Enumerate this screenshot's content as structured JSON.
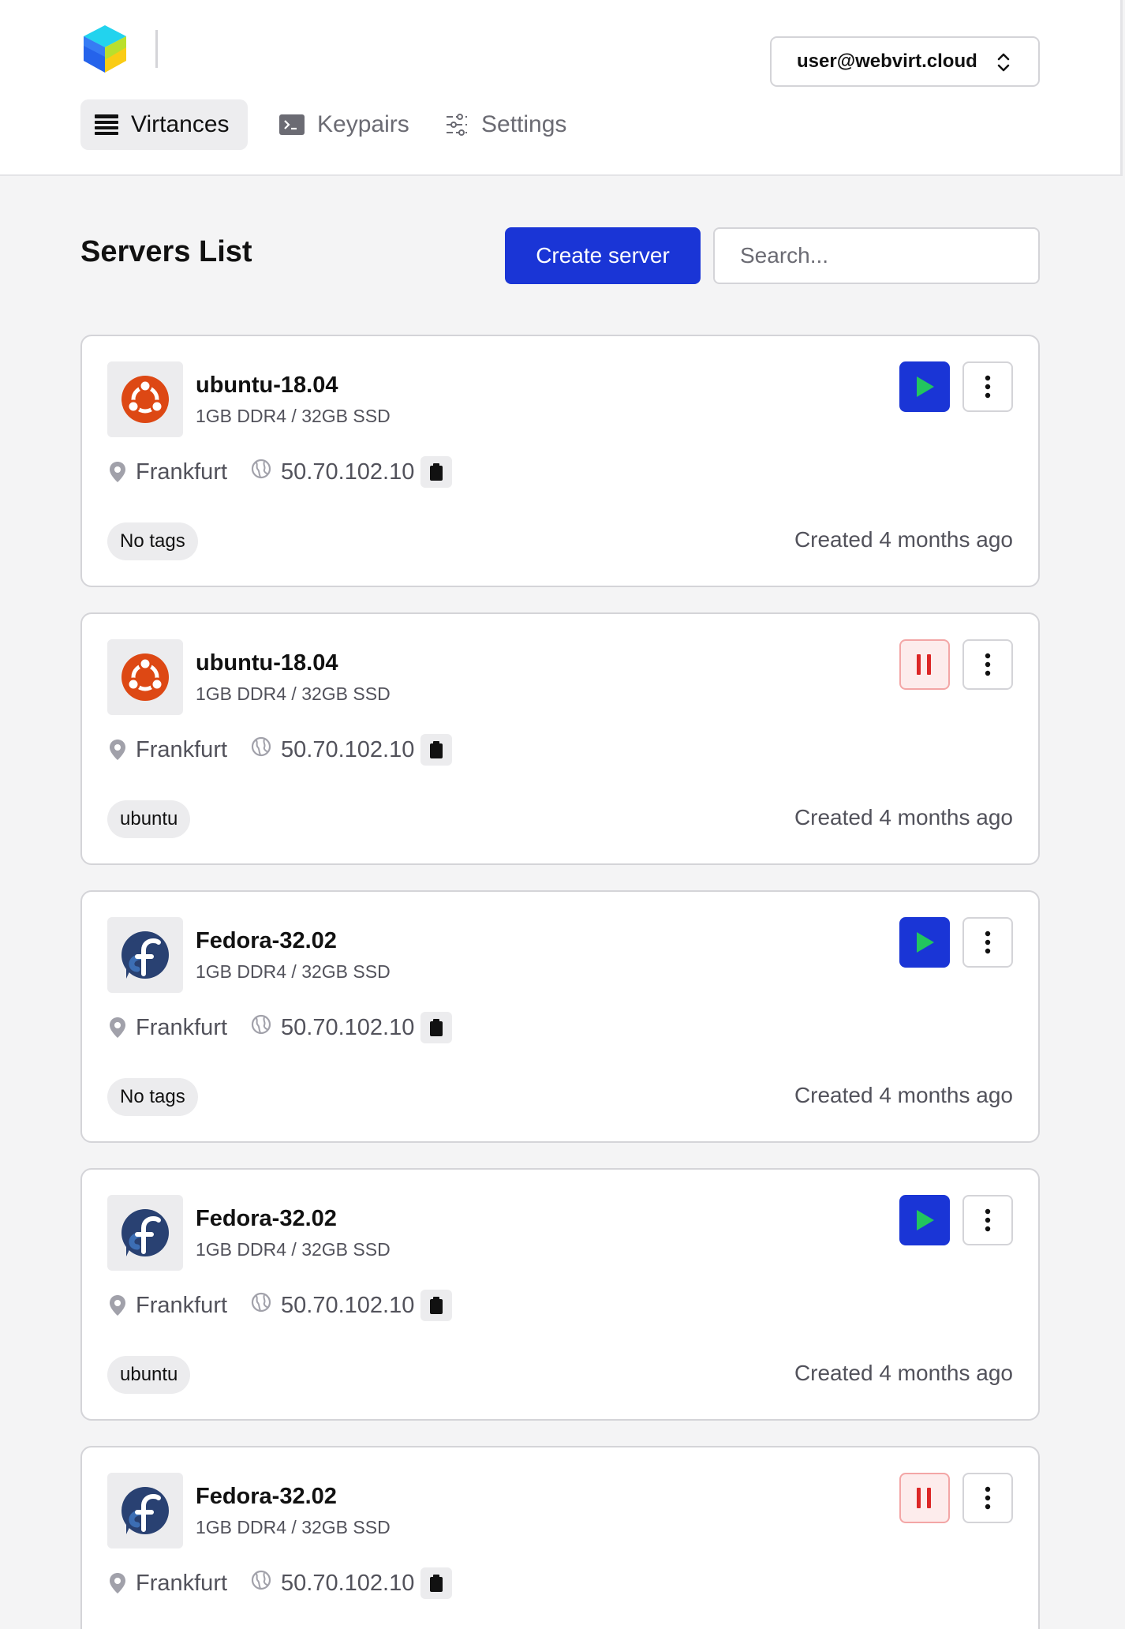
{
  "header": {
    "user_email": "user@webvirt.cloud",
    "nav": [
      {
        "label": "Virtances",
        "icon": "list-icon",
        "active": true
      },
      {
        "label": "Keypairs",
        "icon": "terminal-icon",
        "active": false
      },
      {
        "label": "Settings",
        "icon": "sliders-icon",
        "active": false
      }
    ]
  },
  "page": {
    "title": "Servers List",
    "create_label": "Create server",
    "search_placeholder": "Search..."
  },
  "colors": {
    "accent": "#1a35d6",
    "play_icon": "#22c55e",
    "pause_icon": "#dc2626",
    "ubuntu": "#dd4814",
    "fedora": "#294172",
    "fedora_light": "#3c6eb4"
  },
  "servers": [
    {
      "name": "ubuntu-18.04",
      "spec": "1GB DDR4 / 32GB SSD",
      "os": "ubuntu-logo-icon",
      "status": "stopped",
      "location": "Frankfurt",
      "ip": "50.70.102.10",
      "tag": "No tags",
      "created": "Created 4 months ago"
    },
    {
      "name": "ubuntu-18.04",
      "spec": "1GB DDR4 / 32GB SSD",
      "os": "ubuntu-logo-icon",
      "status": "running",
      "location": "Frankfurt",
      "ip": "50.70.102.10",
      "tag": "ubuntu",
      "created": "Created 4 months ago"
    },
    {
      "name": "Fedora-32.02",
      "spec": "1GB DDR4 / 32GB SSD",
      "os": "fedora-logo-icon",
      "status": "stopped",
      "location": "Frankfurt",
      "ip": "50.70.102.10",
      "tag": "No tags",
      "created": "Created 4 months ago"
    },
    {
      "name": "Fedora-32.02",
      "spec": "1GB DDR4 / 32GB SSD",
      "os": "fedora-logo-icon",
      "status": "stopped",
      "location": "Frankfurt",
      "ip": "50.70.102.10",
      "tag": "ubuntu",
      "created": "Created 4 months ago"
    },
    {
      "name": "Fedora-32.02",
      "spec": "1GB DDR4 / 32GB SSD",
      "os": "fedora-logo-icon",
      "status": "running",
      "location": "Frankfurt",
      "ip": "50.70.102.10",
      "tag": "",
      "created": ""
    }
  ]
}
